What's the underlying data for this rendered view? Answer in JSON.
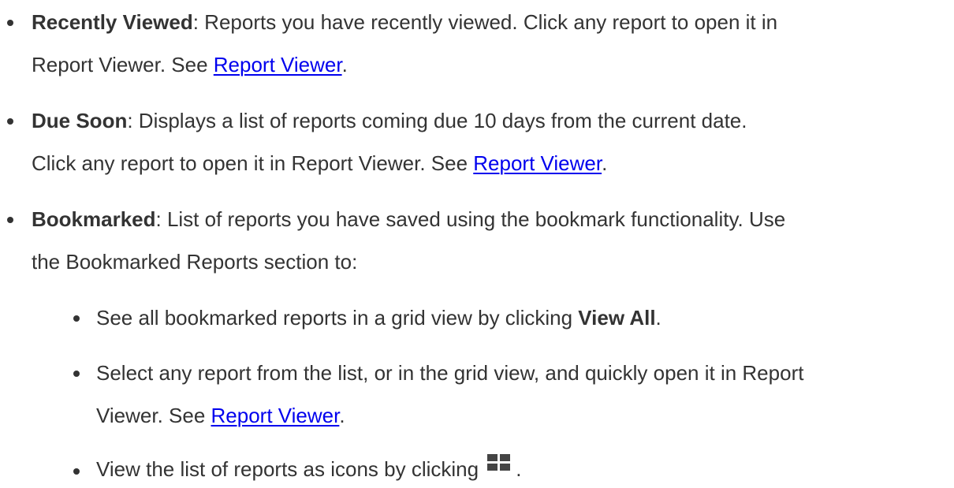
{
  "items": [
    {
      "term": "Recently Viewed",
      "text1": ": Reports you have recently viewed. Click any report to open it in",
      "text2": "Report Viewer. See ",
      "link": "Report Viewer",
      "end": "."
    },
    {
      "term": "Due Soon",
      "text1": ": Displays a list of reports coming due 10 days from the current date.",
      "text2": "Click any report to open it in Report Viewer. See ",
      "link": "Report Viewer",
      "end": "."
    },
    {
      "term": "Bookmarked",
      "text1": ": List of reports you have saved using the bookmark functionality. Use",
      "text2": "the Bookmarked Reports section to:",
      "subitems": [
        {
          "text": "See all bookmarked reports in a grid view by clicking ",
          "bold": "View All",
          "end": "."
        },
        {
          "text1": "Select any report from the list, or in the grid view, and quickly open it in Report",
          "text2": "Viewer. See ",
          "link": "Report Viewer",
          "end": "."
        },
        {
          "text": "View the list of reports as icons by clicking",
          "icon": "grid-view-icon",
          "end": "."
        }
      ]
    }
  ]
}
